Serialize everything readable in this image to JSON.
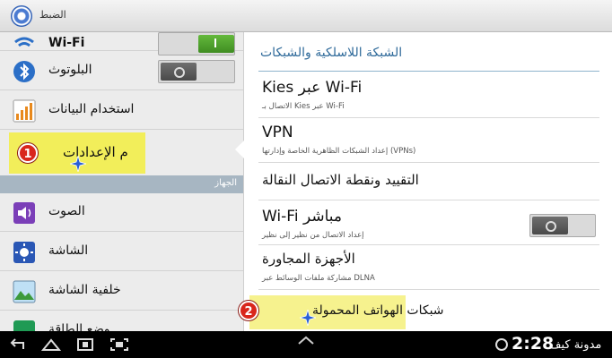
{
  "window": {
    "title": "الضبط"
  },
  "left_pane": {
    "items": [
      {
        "label": "Wi-Fi",
        "toggle": "on"
      },
      {
        "label": "البلوتوث",
        "toggle": "off"
      },
      {
        "label": "استخدام البيانات"
      },
      {
        "label": "م الإعدادات",
        "selected": true
      },
      {
        "label": "الصوت"
      },
      {
        "label": "الشاشة"
      },
      {
        "label": "خلفية الشاشة"
      },
      {
        "label": "وضع الطاقة"
      }
    ],
    "section_header": "الجهاز",
    "annotation_number": "1"
  },
  "right_pane": {
    "header": "الشبكة اللاسلكية والشبكات",
    "items": [
      {
        "title": "Kies عبر Wi-Fi",
        "subtitle": "الاتصال بـ Kies عبر Wi-Fi"
      },
      {
        "title": "VPN",
        "subtitle": "إعداد الشبكات الظاهرية الخاصة وإدارتها (VPNs)"
      },
      {
        "title": "التقييد ونقطة الاتصال النقالة",
        "subtitle": ""
      },
      {
        "title": "Wi-Fi مباشر",
        "subtitle": "إعداد الاتصال من نظير إلى نظير",
        "toggle": "off"
      },
      {
        "title": "الأجهزة المجاورة",
        "subtitle": "مشاركة ملفات الوسائط عبر DLNA"
      },
      {
        "title": "شبكات الهواتف المحمولة",
        "subtitle": ""
      }
    ],
    "annotation_number": "2"
  },
  "navbar": {
    "clock": "2:28",
    "watermark": "مدونة كيف"
  },
  "colors": {
    "accent_blue": "#2f6a9a",
    "highlight_yellow": "#f2ee5a",
    "badge_red": "#d9261c",
    "toggle_on_green": "#4fa52c"
  }
}
